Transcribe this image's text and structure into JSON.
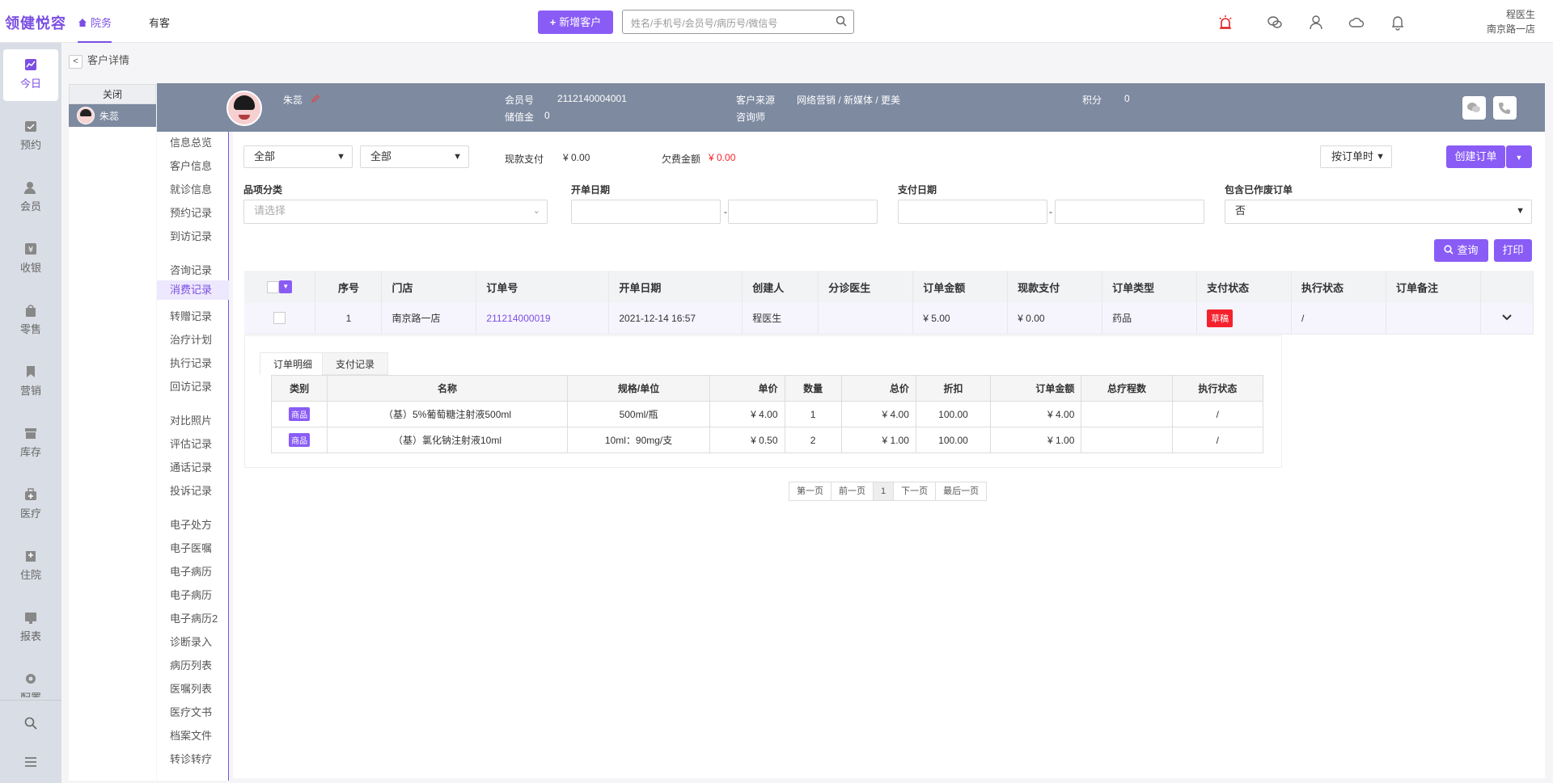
{
  "app": {
    "logo": "领健悦容",
    "tabs": [
      {
        "label": "院务"
      },
      {
        "label": "有客"
      }
    ]
  },
  "top": {
    "new_customer_label": "新增客户",
    "search_placeholder": "姓名/手机号/会员号/病历号/微信号",
    "user_name": "程医生",
    "user_store": "南京路一店"
  },
  "sidebar": {
    "items": [
      {
        "label": "今日",
        "icon": "chart-icon"
      },
      {
        "label": "预约",
        "icon": "calendar-icon"
      },
      {
        "label": "会员",
        "icon": "user-icon"
      },
      {
        "label": "收银",
        "icon": "yen-icon"
      },
      {
        "label": "零售",
        "icon": "bag-icon"
      },
      {
        "label": "营销",
        "icon": "flag-icon"
      },
      {
        "label": "库存",
        "icon": "box-icon"
      },
      {
        "label": "医疗",
        "icon": "medical-icon"
      },
      {
        "label": "住院",
        "icon": "hospital-icon"
      },
      {
        "label": "报表",
        "icon": "report-icon"
      },
      {
        "label": "配置",
        "icon": "settings-icon"
      }
    ]
  },
  "breadcrumb": "客户详情",
  "tablist": {
    "close_label": "关闭",
    "patient_name": "朱蕊"
  },
  "patient": {
    "name": "朱蕊",
    "member_no_label": "会员号",
    "member_no": "2112140004001",
    "deposit_label": "储值金",
    "deposit": "0",
    "source_label": "客户来源",
    "source": "网络营销 / 新媒体 / 更美",
    "consultant_label": "咨询师",
    "points_label": "积分",
    "points": "0"
  },
  "submenu": [
    "信息总览",
    "客户信息",
    "就诊信息",
    "预约记录",
    "到访记录",
    "咨询记录",
    "消费记录",
    "转赠记录",
    "治疗计划",
    "执行记录",
    "回访记录",
    "对比照片",
    "评估记录",
    "通话记录",
    "投诉记录",
    "电子处方",
    "电子医嘱",
    "电子病历",
    "电子病历",
    "电子病历2",
    "诊断录入",
    "病历列表",
    "医嘱列表",
    "医疗文书",
    "档案文件",
    "转诊转疗"
  ],
  "filters": {
    "select1": "全部",
    "select2": "全部",
    "cash_label": "现款支付",
    "cash_value": "¥ 0.00",
    "owe_label": "欠费金额",
    "owe_value": "¥ 0.00",
    "order_by": "按订单时",
    "create_label": "创建订单",
    "category_label": "品项分类",
    "category_placeholder": "请选择",
    "open_date_label": "开单日期",
    "pay_date_label": "支付日期",
    "include_void_label": "包含已作废订单",
    "include_void_value": "否",
    "query_label": "查询",
    "print_label": "打印"
  },
  "orders": {
    "headers": [
      "序号",
      "门店",
      "订单号",
      "开单日期",
      "创建人",
      "分诊医生",
      "订单金额",
      "现款支付",
      "订单类型",
      "支付状态",
      "执行状态",
      "订单备注"
    ],
    "rows": [
      {
        "no": "1",
        "store": "南京路一店",
        "order_no": "211214000019",
        "date": "2021-12-14 16:57",
        "creator": "程医生",
        "doctor": "",
        "amount": "¥ 5.00",
        "cash": "¥ 0.00",
        "type": "药品",
        "pay_status": "草稿",
        "exec_status": "/",
        "remark": ""
      }
    ]
  },
  "detail": {
    "tabs": [
      "订单明细",
      "支付记录"
    ],
    "headers": [
      "类别",
      "名称",
      "规格/单位",
      "单价",
      "数量",
      "总价",
      "折扣",
      "订单金额",
      "总疗程数",
      "执行状态"
    ],
    "rows": [
      {
        "cat": "商品",
        "name": "（基）5%葡萄糖注射液500ml",
        "spec": "500ml/瓶",
        "price": "¥ 4.00",
        "qty": "1",
        "total": "¥ 4.00",
        "discount": "100.00",
        "amount": "¥ 4.00",
        "courses": "",
        "exec": "/"
      },
      {
        "cat": "商品",
        "name": "（基）氯化钠注射液10ml",
        "spec": "10ml：90mg/支",
        "price": "¥ 0.50",
        "qty": "2",
        "total": "¥ 1.00",
        "discount": "100.00",
        "amount": "¥ 1.00",
        "courses": "",
        "exec": "/"
      }
    ]
  },
  "pager": [
    "第一页",
    "前一页",
    "1",
    "下一页",
    "最后一页"
  ],
  "colors": {
    "accent": "#8a5cf6",
    "header_bg": "#7d8aa0",
    "danger": "#f5222d"
  }
}
